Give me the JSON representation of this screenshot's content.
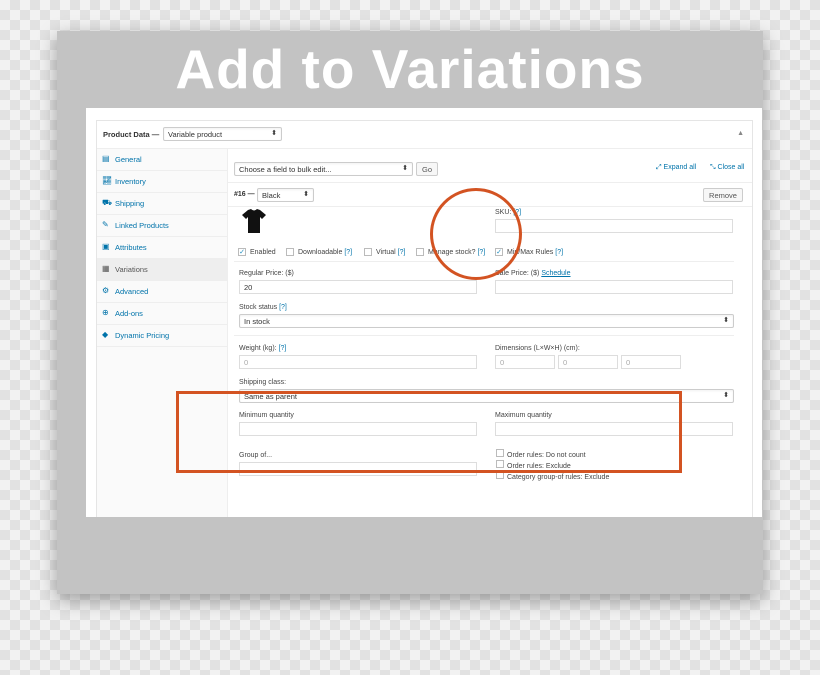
{
  "banner": {
    "title": "Add to Variations"
  },
  "header": {
    "label": "Product Data —",
    "product_type": "Variable product",
    "toggle": "▲"
  },
  "sidebar": {
    "items": [
      {
        "label": "General",
        "icon": "grid-icon"
      },
      {
        "label": "Inventory",
        "icon": "chart-icon"
      },
      {
        "label": "Shipping",
        "icon": "truck-icon"
      },
      {
        "label": "Linked Products",
        "icon": "link-icon"
      },
      {
        "label": "Attributes",
        "icon": "list-icon"
      },
      {
        "label": "Variations",
        "icon": "table-icon"
      },
      {
        "label": "Advanced",
        "icon": "gear-icon"
      },
      {
        "label": "Add-ons",
        "icon": "plus-circle-icon"
      },
      {
        "label": "Dynamic Pricing",
        "icon": "tag-icon"
      }
    ]
  },
  "toolbar": {
    "bulk_select": "Choose a field to bulk edit...",
    "go": "Go",
    "expand_all": "Expand all",
    "close_all": "Close all"
  },
  "variation": {
    "number": "#16 —",
    "attribute": "Black",
    "remove": "Remove",
    "sku_label": "SKU:",
    "sku_help": "[?]",
    "checkboxes": {
      "enabled": "Enabled",
      "downloadable": "Downloadable",
      "downloadable_help": "[?]",
      "virtual": "Virtual",
      "virtual_help": "[?]",
      "manage_stock": "Manage stock?",
      "manage_stock_help": "[?]",
      "min_max": "Min/Max Rules",
      "min_max_help": "[?]"
    },
    "regular_price_label": "Regular Price: ($)",
    "regular_price": "20",
    "sale_price_label": "Sale Price: ($)",
    "schedule": "Schedule",
    "stock_status_label": "Stock status",
    "stock_status_help": "[?]",
    "stock_status": "In stock",
    "weight_label": "Weight (kg):",
    "weight_help": "[?]",
    "weight_placeholder": "0",
    "dimensions_label": "Dimensions (L×W×H) (cm):",
    "dim_l": "0",
    "dim_w": "0",
    "dim_h": "0",
    "shipping_class_label": "Shipping class:",
    "shipping_class": "Same as parent"
  },
  "minmax": {
    "min_label": "Minimum quantity",
    "max_label": "Maximum quantity",
    "group_label": "Group of...",
    "rules": [
      "Order rules: Do not count",
      "Order rules: Exclude",
      "Category group-of rules: Exclude"
    ]
  },
  "colors": {
    "highlight": "#d35322",
    "link": "#0073aa",
    "banner_bg": "#c3c3c3"
  }
}
